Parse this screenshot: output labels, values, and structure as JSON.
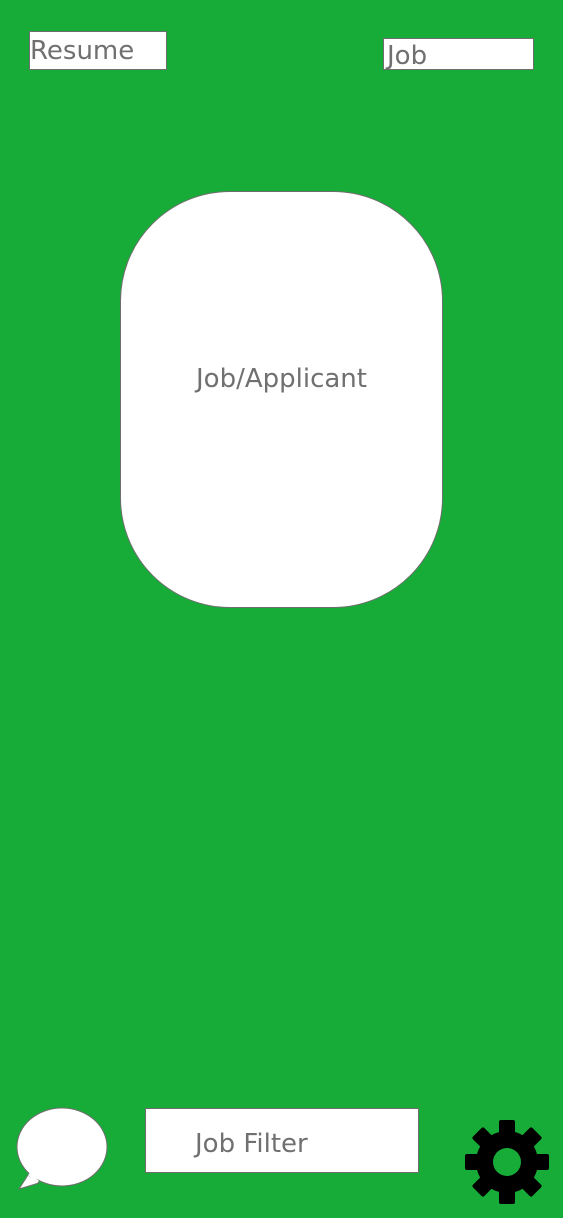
{
  "header": {
    "resume_label": "Resume",
    "job_label": "Job"
  },
  "card": {
    "label": "Job/Applicant"
  },
  "footer": {
    "chat_icon": "speech-bubble-icon",
    "filter_label": "Job Filter",
    "settings_icon": "gear-icon"
  },
  "colors": {
    "background": "#17ac38",
    "surface": "#ffffff",
    "text": "#707070",
    "border": "#6e6e6e",
    "icon": "#000000"
  }
}
